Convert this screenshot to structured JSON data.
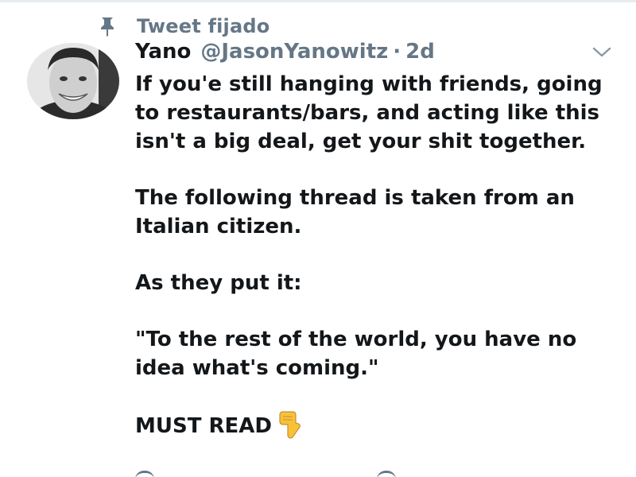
{
  "pinned": {
    "label": "Tweet fijado",
    "icon": "pin-icon"
  },
  "tweet": {
    "display_name": "Yano",
    "handle": "@JasonYanowitz",
    "separator": "·",
    "timestamp": "2d",
    "avatar_icon": "avatar",
    "menu_icon": "chevron-down-icon",
    "paragraphs": [
      "If you'e still hanging with friends, going to restaurants/bars, and acting like this isn't a big deal, get your shit together.",
      "The following thread is taken from an Italian citizen.",
      "As they put it:",
      "\"To the rest of the world, you have no idea what's coming.\"",
      "MUST READ"
    ],
    "emoji": "backhand-index-pointing-down-icon"
  },
  "colors": {
    "text": "#14171a",
    "secondary": "#657786",
    "border": "#e6ecf0"
  }
}
